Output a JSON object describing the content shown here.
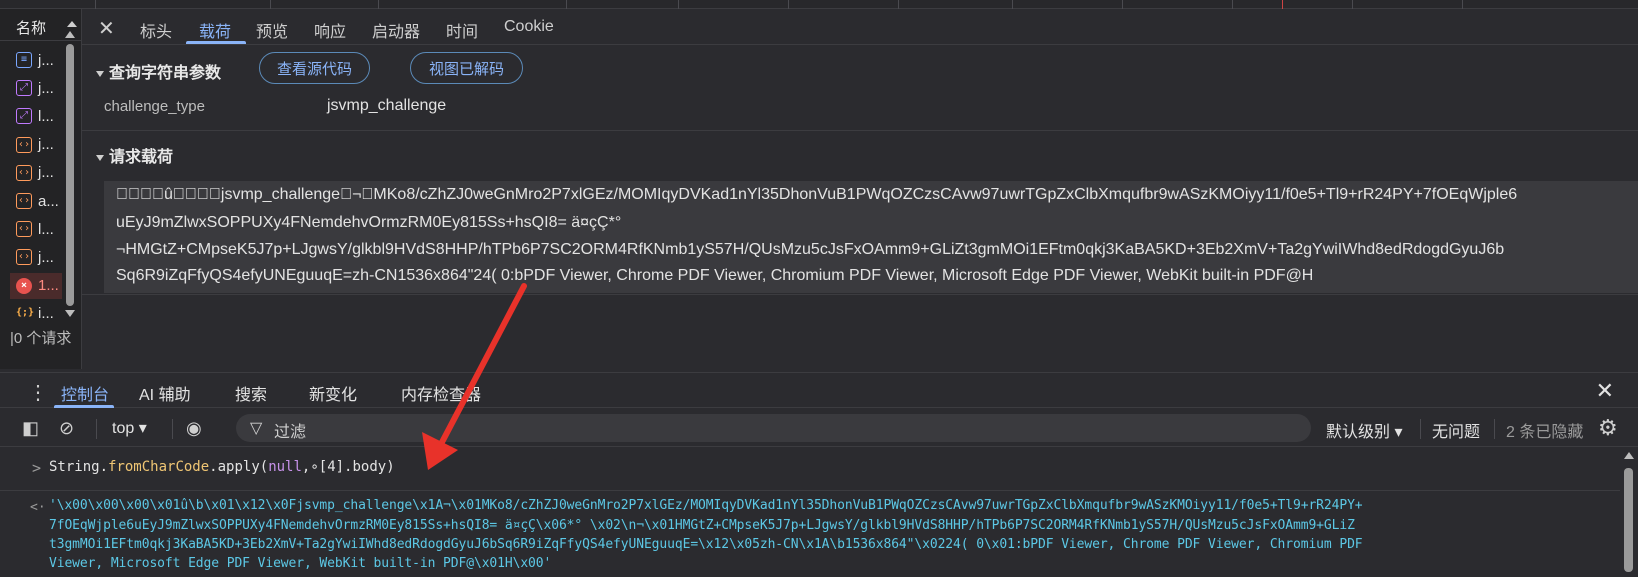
{
  "requests": {
    "column_header": "名称",
    "items": [
      {
        "icon": "document-icon",
        "glyph": "≡",
        "name": "j..."
      },
      {
        "icon": "image-icon",
        "glyph": "⤢",
        "name": "j..."
      },
      {
        "icon": "image-icon",
        "glyph": "⤢",
        "name": "l..."
      },
      {
        "icon": "script-icon",
        "glyph": "‹›",
        "name": "j..."
      },
      {
        "icon": "script-icon",
        "glyph": "‹›",
        "name": "j..."
      },
      {
        "icon": "script-icon",
        "glyph": "‹›",
        "name": "a..."
      },
      {
        "icon": "script-icon",
        "glyph": "‹›",
        "name": "l..."
      },
      {
        "icon": "script-icon",
        "glyph": "‹›",
        "name": "j..."
      },
      {
        "icon": "error-icon",
        "glyph": "×",
        "name": "1..."
      },
      {
        "icon": "json-icon",
        "glyph": "{;}",
        "name": "i..."
      }
    ],
    "footer": "|0 个请求"
  },
  "details": {
    "close_glyph": "✕",
    "tabs": [
      "标头",
      "载荷",
      "预览",
      "响应",
      "启动器",
      "时间",
      "Cookie"
    ],
    "active_tab": "载荷",
    "query_section_title": "查询字符串参数",
    "view_source_label": "查看源代码",
    "view_decoded_label": "视图已解码",
    "params": [
      {
        "key": "challenge_type",
        "value": "jsvmp_challenge"
      }
    ],
    "payload_section_title": "请求载荷",
    "payload_lines": [
      "\u0000\u0000\u0000\u0001û\b\u0001\u0012\u000fjsvmp_challenge\u0012¬\u0001MKo8/cZhZJ0weGnMro2P7xlGEz/MOMIqyDVKad1nYl35DhonVuB1PWqOZCzsCAvw97uwrTGpZxClbXmqufbr9wASzKMOiyy11/f0e5+Tl9+rR24PY+7fOEqWjple6",
      "uEyJ9mZlwxSOPPUXy4FNemdehvOrmzRM0Ey815Ss+hsQI8= ä¤çÇ\u0006*°\u0002",
      "¬\u0001HMGtZ+CMpseK5J7p+LJgwsY/glkbl9HVdS8HHP/hTPb6P7SC2ORM4RfKNmb1yS57H/QUsMzu5cJsFxOAmm9+GLiZt3gmMOi1EFtm0qkj3KaBA5KD+3Eb2XmV+Ta2gYwiIWhd8edRdogdGyuJ6b",
      "Sq6R9iZqFfyQS4efyUNEguuqE=\u0012\u0005zh-CN\u001a\b1536x864\"\u000024( 0\u0001:bPDF Viewer, Chrome PDF Viewer, Chromium PDF Viewer, Microsoft Edge PDF Viewer, WebKit built-in PDF@\u0001H\u0001"
    ]
  },
  "drawer": {
    "tabs": [
      "控制台",
      "AI 辅助",
      "搜索",
      "新变化",
      "内存检查器"
    ],
    "active_tab": "控制台",
    "close_glyph": "✕"
  },
  "toolbar": {
    "context": "top ▾",
    "filter_placeholder": "过滤",
    "level": "默认级别 ▾",
    "issues": "无问题",
    "hidden": "2 条已隐藏"
  },
  "console": {
    "command_prefix": "String.",
    "command_method": "fromCharCode",
    "command_mid": ".apply(",
    "command_null": "null",
    "command_suffix": ",∘[4].body)",
    "input_arrow": ">",
    "output_arrow": "<·",
    "result_lines": [
      "'\\x00\\x00\\x00\\x01û\\b\\x01\\x12\\x0Fjsvmp_challenge\\x1A¬\\x01MKo8/cZhZJ0weGnMro2P7xlGEz/MOMIqyDVKad1nYl35DhonVuB1PWqOZCzsCAvw97uwrTGpZxClbXmqufbr9wASzKMOiyy11/f0e5+Tl9+rR24PY+",
      "7fOEqWjple6uEyJ9mZlwxSOPPUXy4FNemdehvOrmzRM0Ey815Ss+hsQI8= ä¤çÇ\\x06*° \\x02\\n¬\\x01HMGtZ+CMpseK5J7p+LJgwsY/glkbl9HVdS8HHP/hTPb6P7SC2ORM4RfKNmb1yS57H/QUsMzu5cJsFxOAmm9+GLiZ",
      "t3gmMOi1EFtm0qkj3KaBA5KD+3Eb2XmV+Ta2gYwiIWhd8edRdogdGyuJ6bSq6R9iZqFfyQS4efyUNEguuqE=\\x12\\x05zh-CN\\x1A\\b1536x864\"\\x0224( 0\\x01:bPDF Viewer, Chrome PDF Viewer, Chromium PDF",
      "Viewer, Microsoft Edge PDF Viewer, WebKit built-in PDF@\\x01H\\x00'"
    ]
  },
  "colors": {
    "accent": "#8ab4f8",
    "annotation_arrow": "#e8322a",
    "result_text": "#5cc8e6"
  }
}
